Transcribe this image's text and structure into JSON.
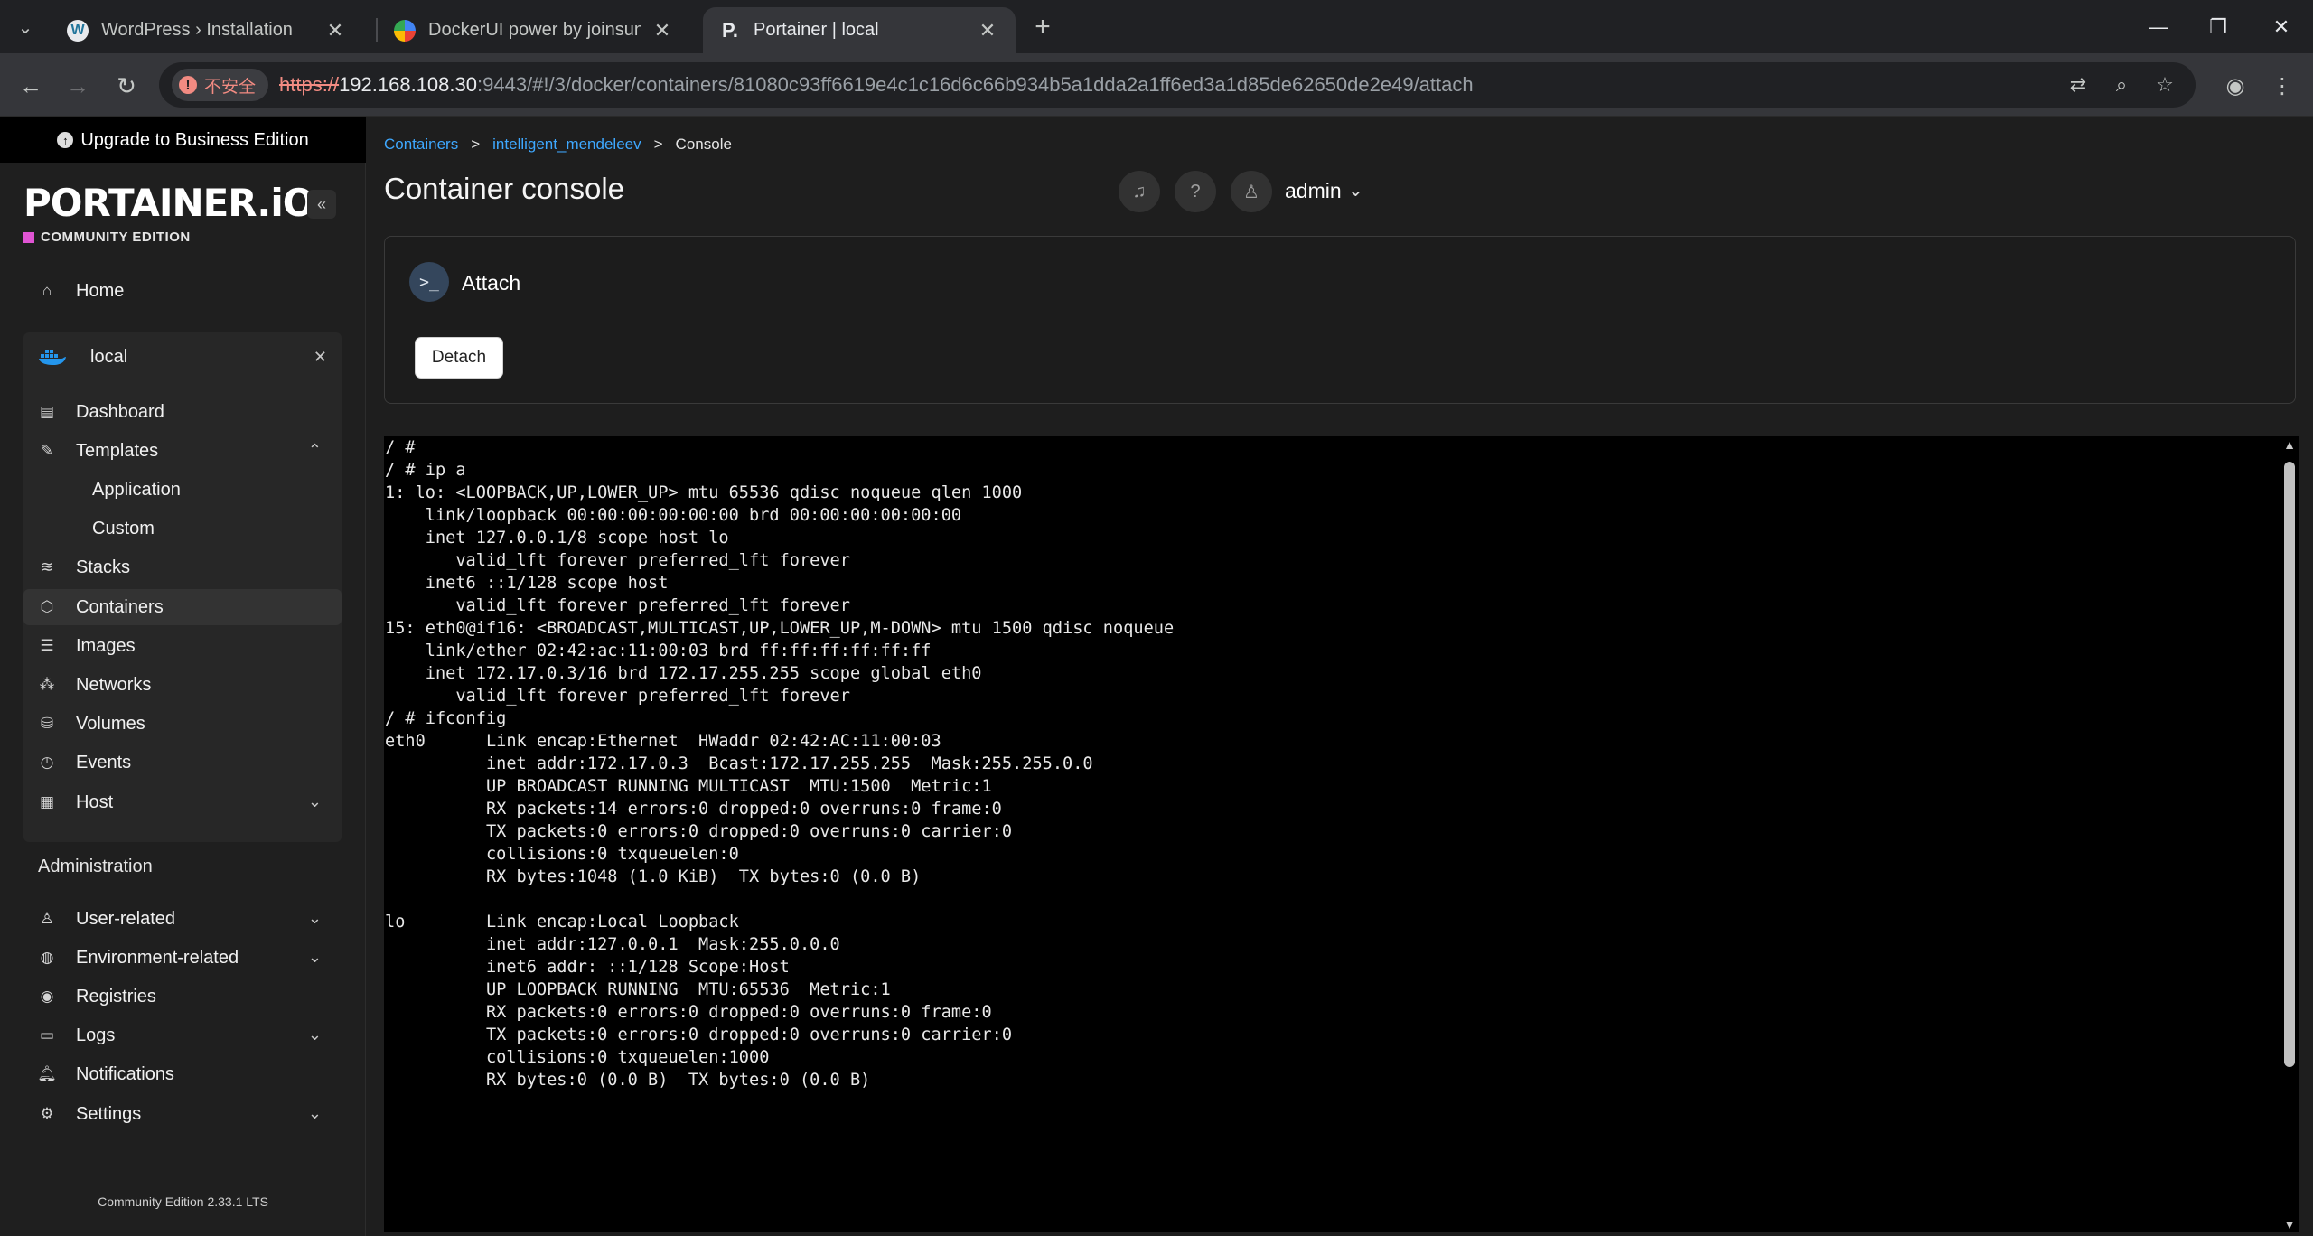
{
  "browser": {
    "tabs": [
      {
        "title": "WordPress › Installation",
        "favicon": "wordpress-icon"
      },
      {
        "title": "DockerUI power by joinsunsoft",
        "favicon": "dockerui-icon"
      },
      {
        "title": "Portainer | local",
        "favicon": "portainer-icon",
        "active": true
      }
    ],
    "security_label": "不安全",
    "url_scheme": "https://",
    "url_host": "192.168.108.30",
    "url_rest": ":9443/#!/3/docker/containers/81080c93ff6619e4c1c16d6c66b934b5a1dda2a1ff6ed3a1d85de62650de2e49/attach"
  },
  "sidebar": {
    "upgrade_label": "Upgrade to Business Edition",
    "logo_text": "PORTAINER.iO",
    "logo_sub": "COMMUNITY EDITION",
    "home": "Home",
    "environment": "local",
    "items": {
      "dashboard": "Dashboard",
      "templates": "Templates",
      "application": "Application",
      "custom": "Custom",
      "stacks": "Stacks",
      "containers": "Containers",
      "images": "Images",
      "networks": "Networks",
      "volumes": "Volumes",
      "events": "Events",
      "host": "Host"
    },
    "admin_heading": "Administration",
    "admin_items": {
      "user_related": "User-related",
      "environment_related": "Environment-related",
      "registries": "Registries",
      "logs": "Logs",
      "notifications": "Notifications",
      "settings": "Settings"
    },
    "version": "Community Edition 2.33.1 LTS"
  },
  "main": {
    "breadcrumb": {
      "containers": "Containers",
      "container": "intelligent_mendeleev",
      "current": "Console"
    },
    "title": "Container console",
    "user": "admin",
    "widget_title": "Attach",
    "detach_label": "Detach",
    "terminal_lines": [
      "/ #",
      "/ # ip a",
      "1: lo: <LOOPBACK,UP,LOWER_UP> mtu 65536 qdisc noqueue qlen 1000",
      "    link/loopback 00:00:00:00:00:00 brd 00:00:00:00:00:00",
      "    inet 127.0.0.1/8 scope host lo",
      "       valid_lft forever preferred_lft forever",
      "    inet6 ::1/128 scope host",
      "       valid_lft forever preferred_lft forever",
      "15: eth0@if16: <BROADCAST,MULTICAST,UP,LOWER_UP,M-DOWN> mtu 1500 qdisc noqueue",
      "    link/ether 02:42:ac:11:00:03 brd ff:ff:ff:ff:ff:ff",
      "    inet 172.17.0.3/16 brd 172.17.255.255 scope global eth0",
      "       valid_lft forever preferred_lft forever",
      "/ # ifconfig",
      "eth0      Link encap:Ethernet  HWaddr 02:42:AC:11:00:03",
      "          inet addr:172.17.0.3  Bcast:172.17.255.255  Mask:255.255.0.0",
      "          UP BROADCAST RUNNING MULTICAST  MTU:1500  Metric:1",
      "          RX packets:14 errors:0 dropped:0 overruns:0 frame:0",
      "          TX packets:0 errors:0 dropped:0 overruns:0 carrier:0",
      "          collisions:0 txqueuelen:0",
      "          RX bytes:1048 (1.0 KiB)  TX bytes:0 (0.0 B)",
      "",
      "lo        Link encap:Local Loopback",
      "          inet addr:127.0.0.1  Mask:255.0.0.0",
      "          inet6 addr: ::1/128 Scope:Host",
      "          UP LOOPBACK RUNNING  MTU:65536  Metric:1",
      "          RX packets:0 errors:0 dropped:0 overruns:0 frame:0",
      "          TX packets:0 errors:0 dropped:0 overruns:0 carrier:0",
      "          collisions:0 txqueuelen:1000",
      "          RX bytes:0 (0.0 B)  TX bytes:0 (0.0 B)"
    ]
  },
  "colors": {
    "accent_link": "#3ea8ff",
    "logo_square": "#e054d3",
    "docker_blue": "#2496ed",
    "insecure_red": "#f28b82"
  }
}
